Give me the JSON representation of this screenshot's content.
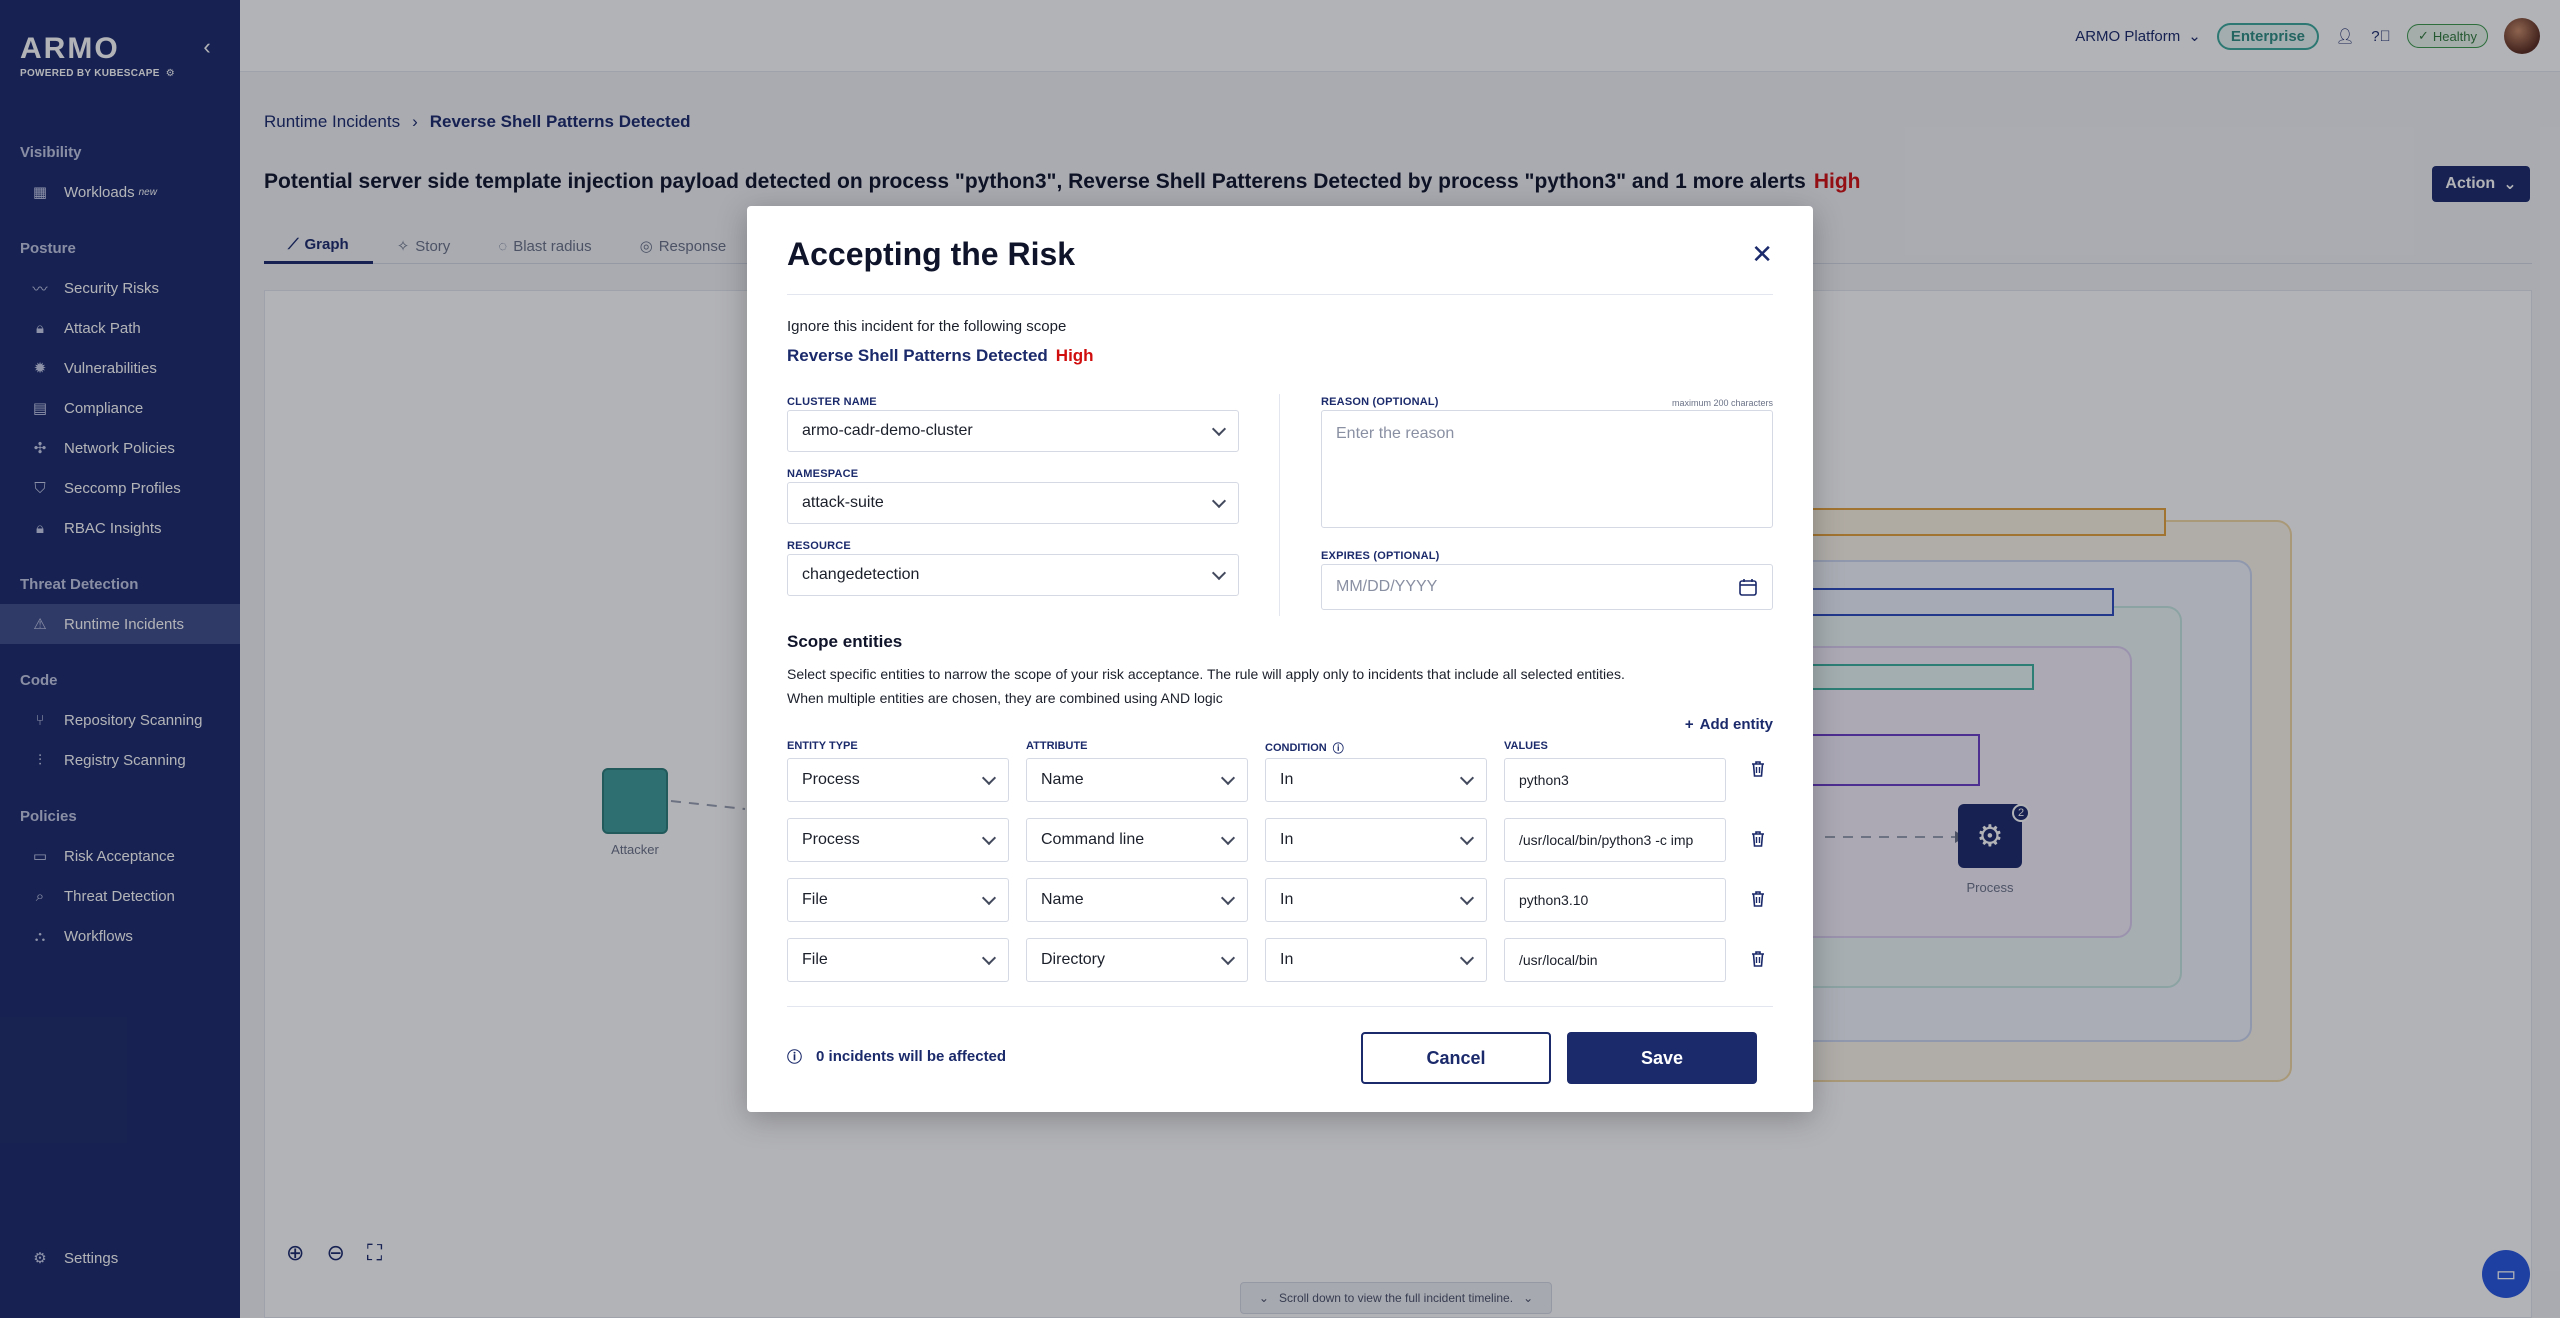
{
  "sidebar": {
    "brand": "ARMO",
    "powered_by": "POWERED BY KUBESCAPE",
    "sections": {
      "visibility": "Visibility",
      "posture": "Posture",
      "threat_detection": "Threat Detection",
      "code": "Code",
      "policies": "Policies"
    },
    "items": {
      "workloads": "Workloads",
      "workloads_badge": "new",
      "security_risks": "Security Risks",
      "attack_path": "Attack Path",
      "vulnerabilities": "Vulnerabilities",
      "compliance": "Compliance",
      "network_policies": "Network Policies",
      "seccomp_profiles": "Seccomp Profiles",
      "rbac_insights": "RBAC Insights",
      "runtime_incidents": "Runtime Incidents",
      "repository_scanning": "Repository Scanning",
      "registry_scanning": "Registry Scanning",
      "risk_acceptance": "Risk Acceptance",
      "threat_detection": "Threat Detection",
      "workflows": "Workflows",
      "settings": "Settings"
    }
  },
  "topbar": {
    "platform": "ARMO Platform",
    "plan_badge": "Enterprise",
    "health": "Healthy"
  },
  "page": {
    "breadcrumb_root": "Runtime Incidents",
    "breadcrumb_current": "Reverse Shell Patterns Detected",
    "title": "Potential server side template injection payload detected on process \"python3\", Reverse Shell Patterens Detected by process \"python3\" and 1 more alerts",
    "severity": "High",
    "action_label": "Action",
    "tabs": {
      "graph": "Graph",
      "story": "Story",
      "blast_radius": "Blast radius",
      "response": "Response"
    },
    "graph": {
      "attacker_label": "Attacker",
      "process_label": "Process",
      "process_count": "2"
    },
    "scroll_hint": "Scroll down to view the full incident timeline."
  },
  "modal": {
    "title": "Accepting the Risk",
    "subtitle": "Ignore this incident for the following scope",
    "scope_name": "Reverse Shell Patterns Detected",
    "scope_severity": "High",
    "cluster_label": "CLUSTER NAME",
    "cluster_value": "armo-cadr-demo-cluster",
    "namespace_label": "NAMESPACE",
    "namespace_value": "attack-suite",
    "resource_label": "RESOURCE",
    "resource_value": "changedetection",
    "reason_label": "REASON (OPTIONAL)",
    "reason_max": "maximum 200 characters",
    "reason_placeholder": "Enter the reason",
    "expires_label": "EXPIRES (OPTIONAL)",
    "expires_placeholder": "MM/DD/YYYY",
    "scope_heading": "Scope entities",
    "scope_desc_1": "Select specific entities to narrow the scope of your risk acceptance. The rule will apply only to incidents that include all selected entities.",
    "scope_desc_2": "When multiple entities are chosen, they are combined using AND logic",
    "add_entity": "Add entity",
    "columns": {
      "entity_type": "ENTITY TYPE",
      "attribute": "ATTRIBUTE",
      "condition": "CONDITION",
      "values": "VALUES"
    },
    "rows": [
      {
        "entity": "Process",
        "attribute": "Name",
        "condition": "In",
        "value": "python3"
      },
      {
        "entity": "Process",
        "attribute": "Command line",
        "condition": "In",
        "value": "/usr/local/bin/python3 -c imp"
      },
      {
        "entity": "File",
        "attribute": "Name",
        "condition": "In",
        "value": "python3.10"
      },
      {
        "entity": "File",
        "attribute": "Directory",
        "condition": "In",
        "value": "/usr/local/bin"
      }
    ],
    "affected": "0 incidents will be affected",
    "cancel": "Cancel",
    "save": "Save"
  }
}
